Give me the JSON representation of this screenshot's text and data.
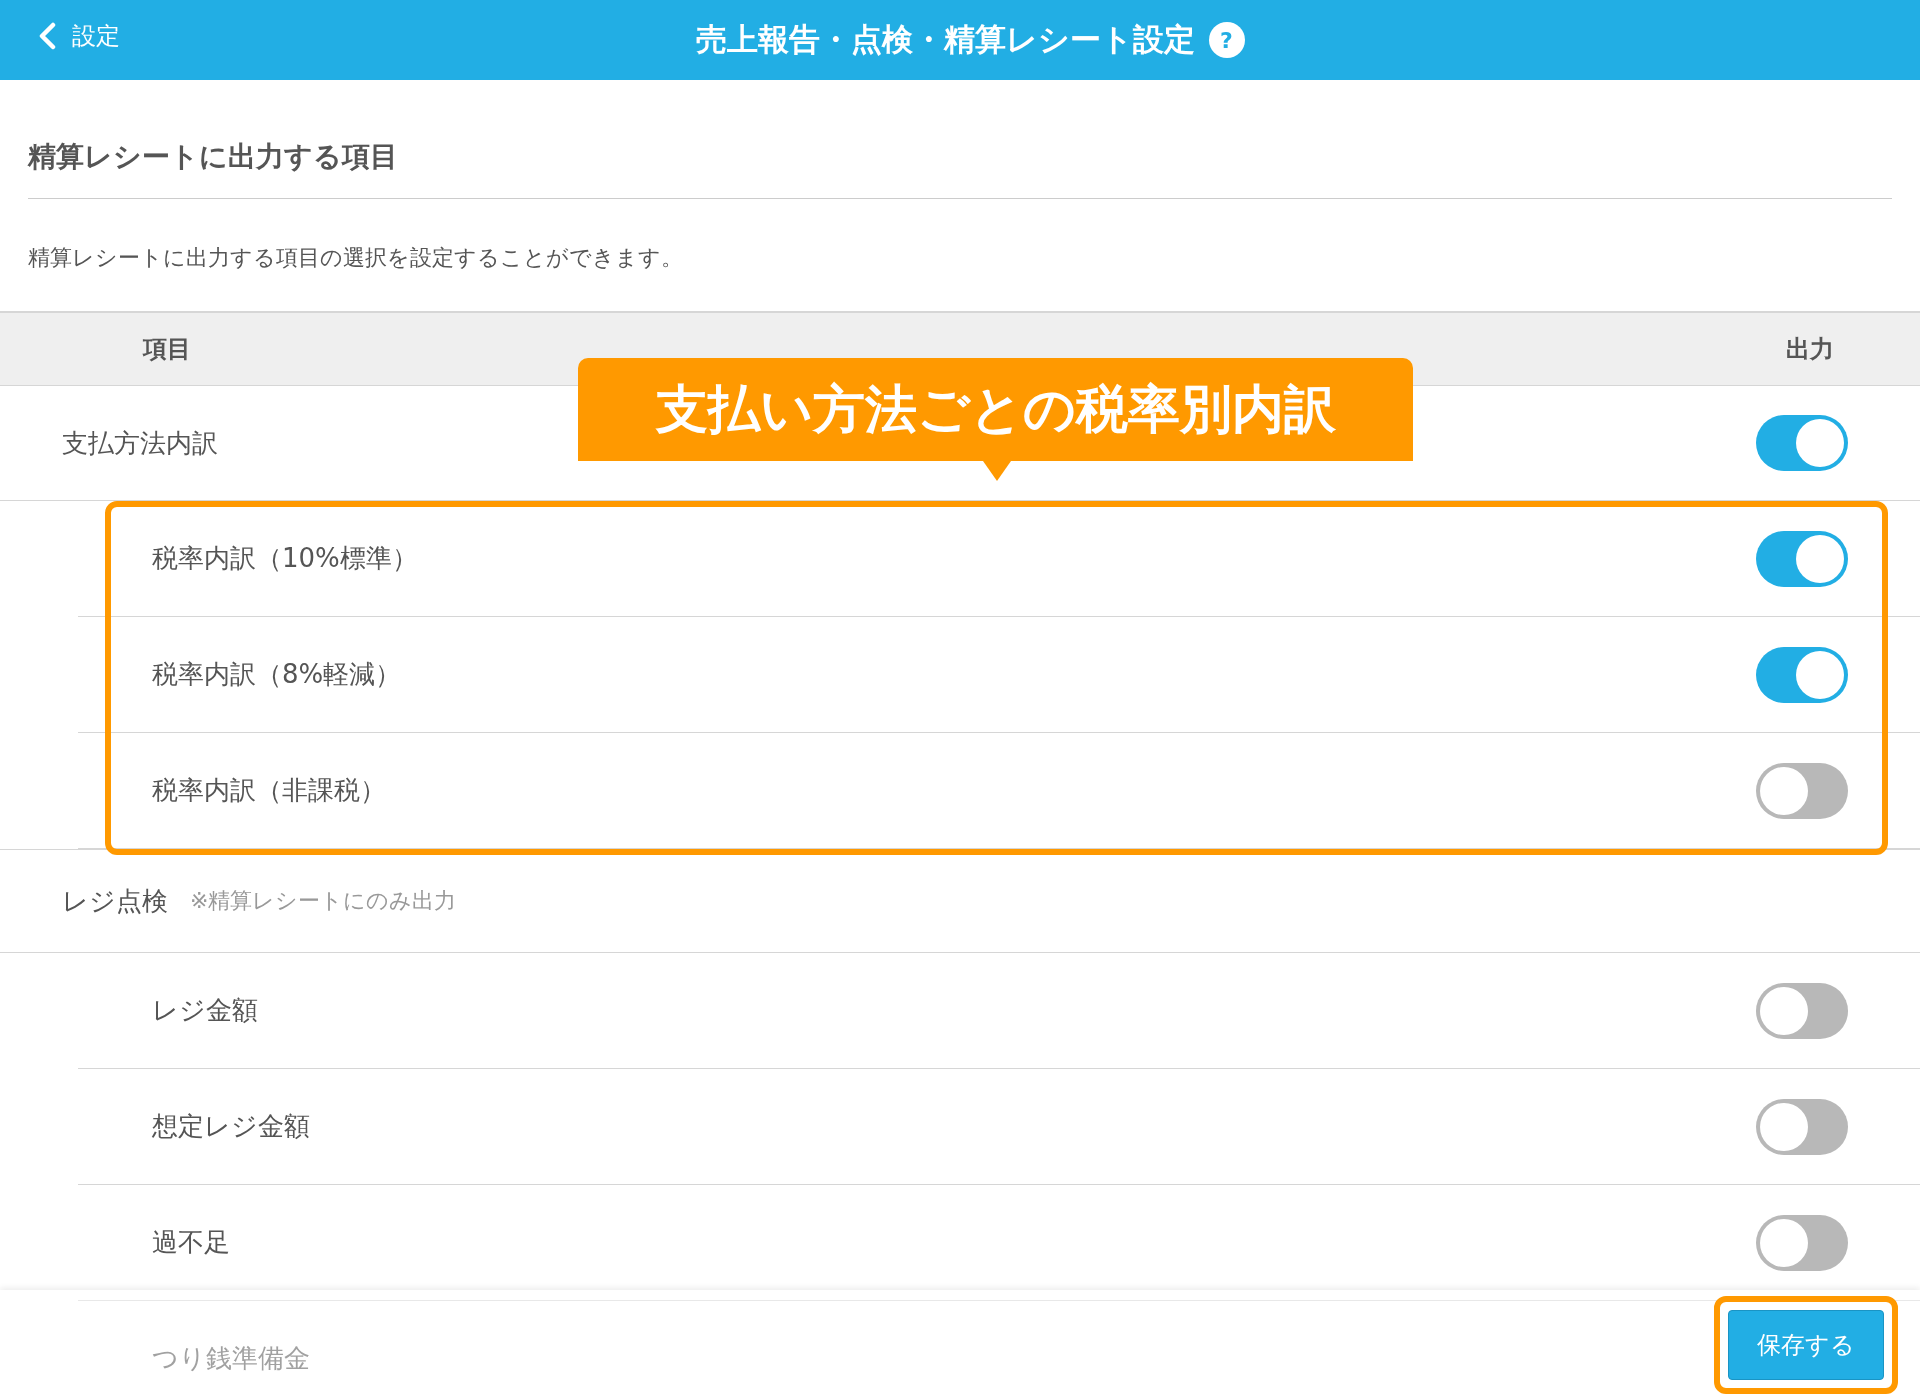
{
  "header": {
    "back_label": "設定",
    "title": "売上報告・点検・精算レシート設定",
    "help": "?"
  },
  "section": {
    "title": "精算レシートに出力する項目",
    "description": "精算レシートに出力する項目の選択を設定することができます。"
  },
  "table": {
    "columns": [
      "項目",
      "出力"
    ],
    "groups": [
      {
        "label": "支払方法内訳",
        "kind": "toggle",
        "on": true,
        "highlighted": true,
        "children": [
          {
            "label": "税率内訳（10%標準）",
            "on": true
          },
          {
            "label": "税率内訳（8%軽減）",
            "on": true
          },
          {
            "label": "税率内訳（非課税）",
            "on": false
          }
        ]
      },
      {
        "label": "レジ点検",
        "kind": "heading",
        "note": "※精算レシートにのみ出力",
        "highlighted": false,
        "children": [
          {
            "label": "レジ金額",
            "on": false
          },
          {
            "label": "想定レジ金額",
            "on": false
          },
          {
            "label": "過不足",
            "on": false
          },
          {
            "label": "つり銭準備金"
          }
        ]
      }
    ]
  },
  "callout": {
    "text": "支払い方法ごとの税率別内訳"
  },
  "save_button": {
    "label": "保存する",
    "highlighted": true
  }
}
